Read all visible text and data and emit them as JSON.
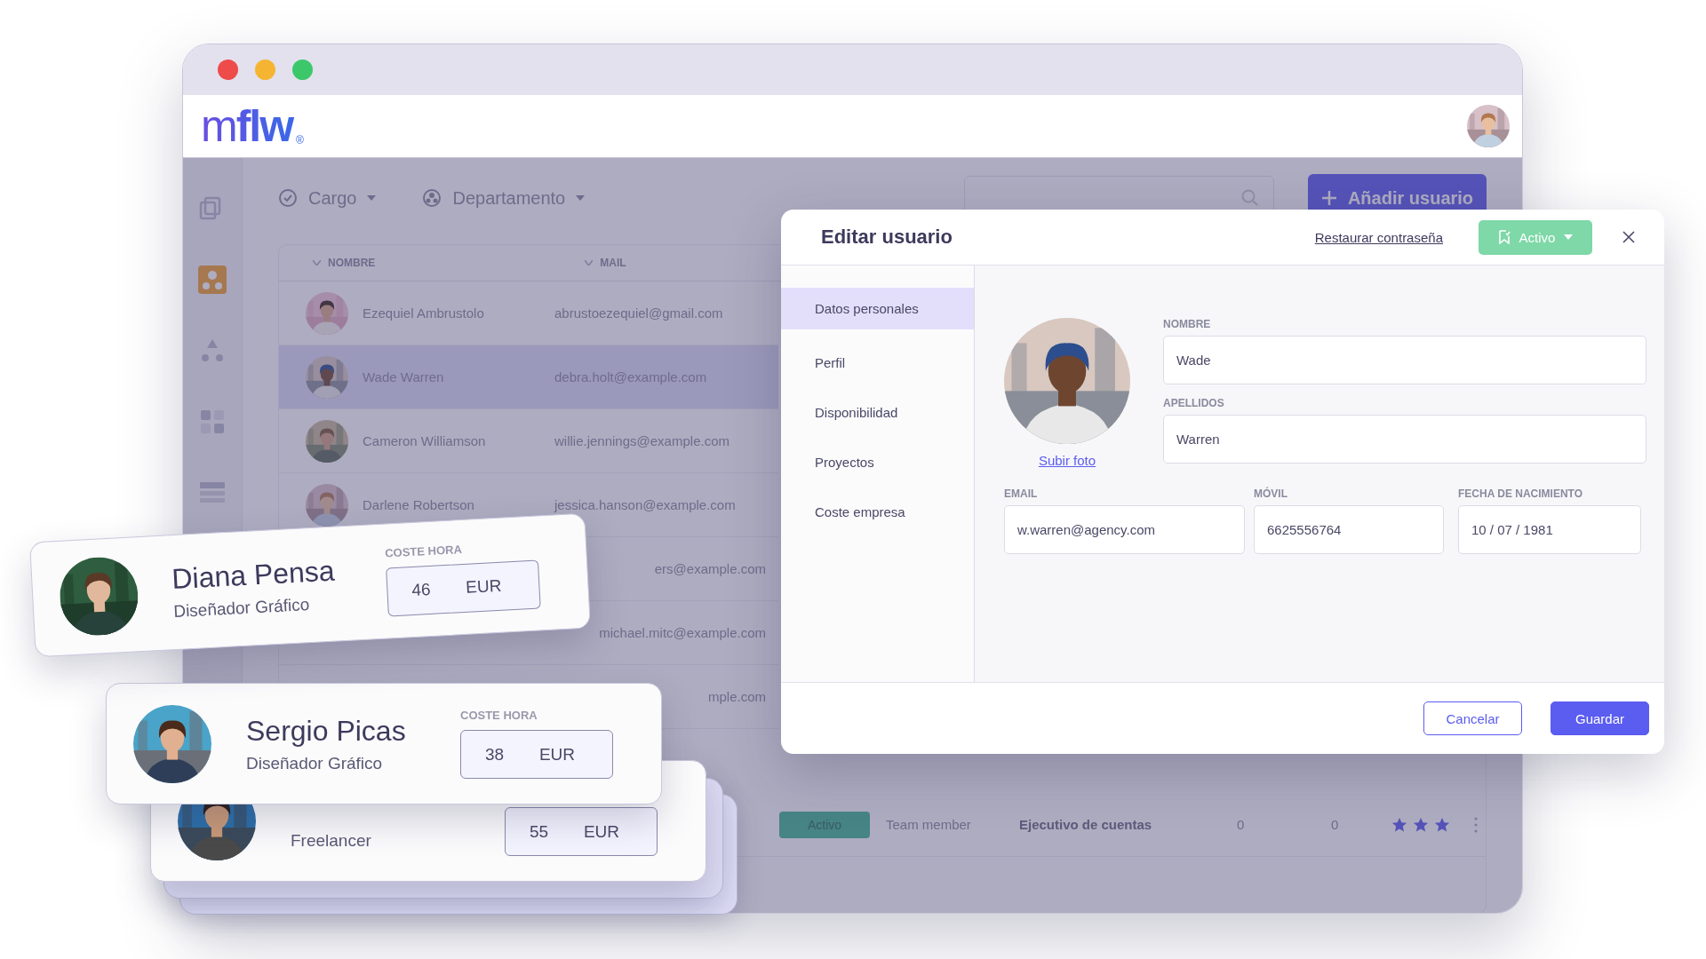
{
  "window": {
    "logo": "m**flw**",
    "logo_mark": "®"
  },
  "sidebar": {
    "items": [
      {
        "selected": false
      },
      {
        "selected": true
      },
      {
        "selected": false
      },
      {
        "selected": false
      },
      {
        "selected": false
      }
    ]
  },
  "filters": [
    {
      "label": "Cargo"
    },
    {
      "label": "Departamento"
    }
  ],
  "add_button": {
    "label": "Añadir usuario"
  },
  "table": {
    "columns": [
      "NOMBRE",
      "MAIL"
    ],
    "rows": [
      {
        "kind": "person",
        "name": "Ezequiel Ambrustolo",
        "email": "abrustoezequiel@gmail.com",
        "selected": false
      },
      {
        "kind": "person",
        "name": "Wade Warren",
        "email": "debra.holt@example.com",
        "selected": true
      },
      {
        "kind": "person",
        "name": "Cameron Williamson",
        "email": "willie.jennings@example.com",
        "selected": false
      },
      {
        "kind": "person",
        "name": "Darlene Robertson",
        "email": "jessica.hanson@example.com",
        "selected": false
      },
      {
        "kind": "partial",
        "email": "ers@example.com",
        "selected": false
      },
      {
        "kind": "partial",
        "email": "michael.mitc@example.com",
        "selected": false
      },
      {
        "kind": "partial",
        "email": "mple.com",
        "selected": false
      },
      {
        "kind": "detail",
        "status": "Activo",
        "role": "Team member",
        "position": "Ejecutivo de cuentas",
        "column_5": "0",
        "column_6": "0",
        "stars": 3,
        "selected": false
      }
    ]
  },
  "edit_modal": {
    "title": "Editar usuario",
    "reset_link": "Restaurar contraseña",
    "status_button": "Activo",
    "nav": [
      {
        "label": "Datos personales",
        "selected": true
      },
      {
        "label": "Perfil",
        "selected": false
      },
      {
        "label": "Disponibilidad",
        "selected": false
      },
      {
        "label": "Proyectos",
        "selected": false
      },
      {
        "label": "Coste empresa",
        "selected": false
      }
    ],
    "upload_link": "Subir foto",
    "fields": [
      {
        "label": "NOMBRE",
        "value": "Wade"
      },
      {
        "label": "APELLIDOS",
        "value": "Warren"
      },
      {
        "label": "EMAIL",
        "value": "w.warren@agency.com"
      },
      {
        "label": "MÓVIL",
        "value": "6625556764"
      },
      {
        "label": "FECHA DE NACIMIENTO",
        "value": "10 / 07 / 1981"
      }
    ],
    "buttons": [
      {
        "label": "Cancelar",
        "kind": "secondary"
      },
      {
        "label": "Guardar",
        "kind": "primary"
      }
    ]
  },
  "cost_cards": [
    {
      "name": "Diana Pensa",
      "role": "Diseñador Gráfico",
      "cost_label": "COSTE HORA",
      "value": "46",
      "currency": "EUR"
    },
    {
      "name": "Sergio Picas",
      "role": "Diseñador Gráfico",
      "cost_label": "COSTE HORA",
      "value": "38",
      "currency": "EUR"
    },
    {
      "role": "Freelancer",
      "value": "55",
      "currency": "EUR"
    }
  ]
}
